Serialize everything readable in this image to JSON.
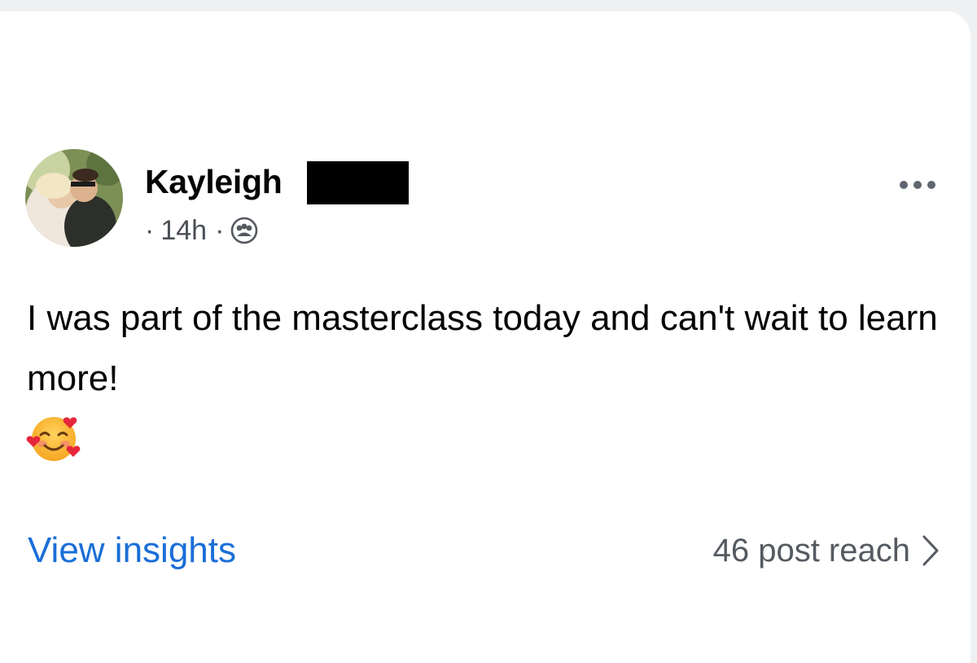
{
  "post": {
    "author": {
      "name": "Kayleigh",
      "name_redacted": true
    },
    "meta": {
      "separator": "·",
      "time": "14h",
      "audience_icon": "friends-icon"
    },
    "text": "I was part of the masterclass today and can't wait to learn more!",
    "emoji": "smiling-face-with-hearts",
    "footer": {
      "insights_label": "View insights",
      "reach_label": "46 post reach"
    }
  },
  "colors": {
    "link": "#1a6ed8",
    "text": "#050505",
    "muted": "#555a61",
    "background": "#eef0f2",
    "card": "#ffffff"
  }
}
